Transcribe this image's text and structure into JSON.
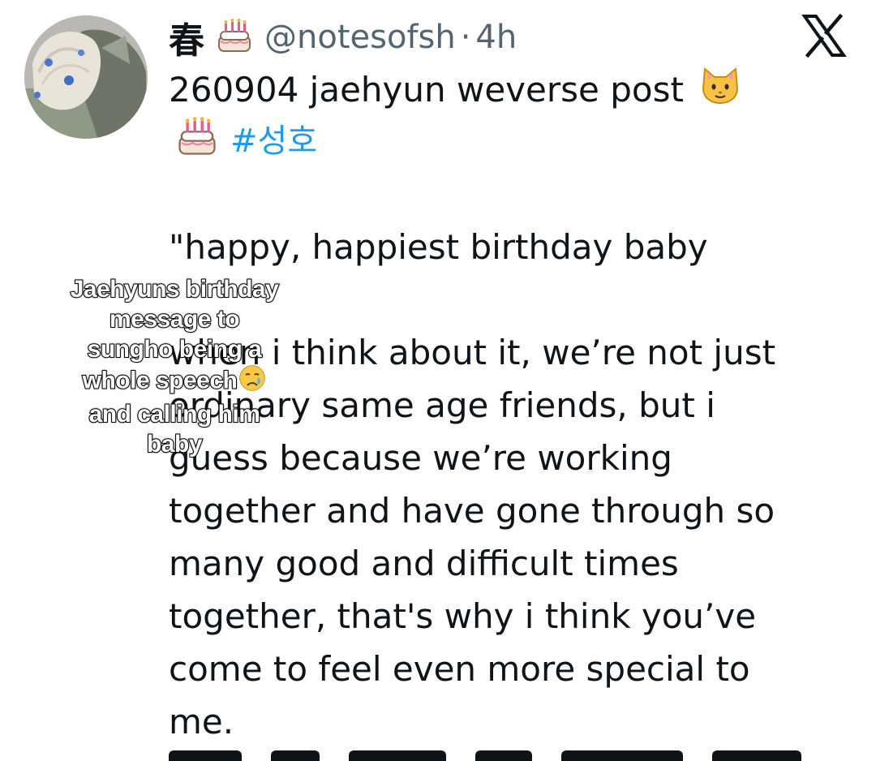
{
  "tweet": {
    "author": {
      "display_name": "春",
      "handle": "@notesofsh",
      "separator": "·",
      "timestamp": "4h",
      "name_emoji": "birthday-cake-emoji"
    },
    "title": "260904 jaehyun weverse post",
    "title_emoji": "cat-face-emoji",
    "hashtag_emoji": "birthday-cake-emoji",
    "hashtag": "#성호",
    "body_lines": [
      "\"happy, happiest birthday baby",
      "",
      "when i think about it, we’re not just",
      "ordinary same age friends, but i",
      "guess because we’re working",
      "together and have gone through so",
      "many good and difficult times",
      "together, that's why i think you’ve",
      "come to feel even more special to",
      "me."
    ]
  },
  "platform": {
    "logo": "x-logo-icon"
  },
  "overlay": {
    "caption_lines": [
      "Jaehyuns birthday",
      "message to",
      "sungho being a",
      "whole speech",
      "and calling him",
      "baby"
    ],
    "caption_emoji": "crying-face-emoji"
  },
  "colors": {
    "text": "#0f1419",
    "secondary": "#536471",
    "hashtag": "#1d9bf0",
    "background": "#ffffff"
  }
}
